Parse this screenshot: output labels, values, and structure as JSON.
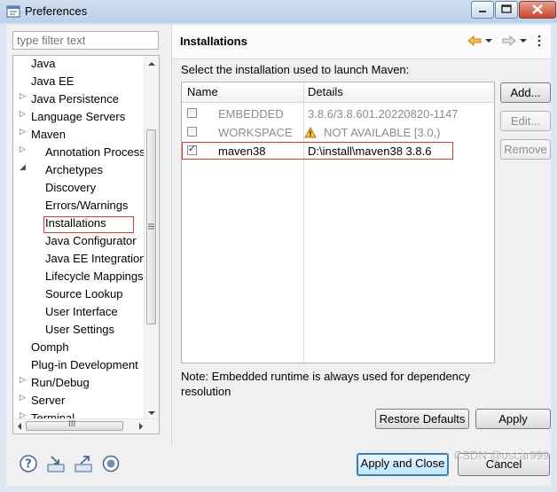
{
  "window": {
    "title": "Preferences"
  },
  "filter": {
    "placeholder": "type filter text"
  },
  "tree": {
    "items": [
      {
        "label": "Java"
      },
      {
        "label": "Java EE"
      },
      {
        "label": "Java Persistence"
      },
      {
        "label": "Language Servers"
      },
      {
        "label": "Maven"
      },
      {
        "label": "Annotation Process"
      },
      {
        "label": "Archetypes"
      },
      {
        "label": "Discovery"
      },
      {
        "label": "Errors/Warnings"
      },
      {
        "label": "Installations"
      },
      {
        "label": "Java Configurator"
      },
      {
        "label": "Java EE Integration"
      },
      {
        "label": "Lifecycle Mappings"
      },
      {
        "label": "Source Lookup"
      },
      {
        "label": "User Interface"
      },
      {
        "label": "User Settings"
      },
      {
        "label": "Oomph"
      },
      {
        "label": "Plug-in Development"
      },
      {
        "label": "Run/Debug"
      },
      {
        "label": "Server"
      },
      {
        "label": "Terminal"
      }
    ],
    "hscroll_grip": "III"
  },
  "page": {
    "title": "Installations",
    "description": "Select the installation used to launch Maven:",
    "columns": {
      "name": "Name",
      "details": "Details"
    },
    "rows": [
      {
        "name": "EMBEDDED",
        "details": "3.8.6/3.8.601.20220820-1147",
        "checked": false
      },
      {
        "name": "WORKSPACE",
        "details": "NOT AVAILABLE [3.0,)",
        "checked": false
      },
      {
        "name": "maven38",
        "details": "D:\\install\\maven38 3.8.6",
        "checked": true
      }
    ],
    "buttons": {
      "add": "Add...",
      "edit": "Edit...",
      "remove": "Remove"
    },
    "note": "Note: Embedded runtime is always used for dependency resolution",
    "restore_defaults": "Restore Defaults",
    "apply": "Apply"
  },
  "footer": {
    "apply_close": "Apply and Close",
    "cancel": "Cancel",
    "watermark": "CSDN @oscar999"
  },
  "colors": {
    "selection_outline": "#d03c3c",
    "default_button": "#3c7fb1"
  }
}
